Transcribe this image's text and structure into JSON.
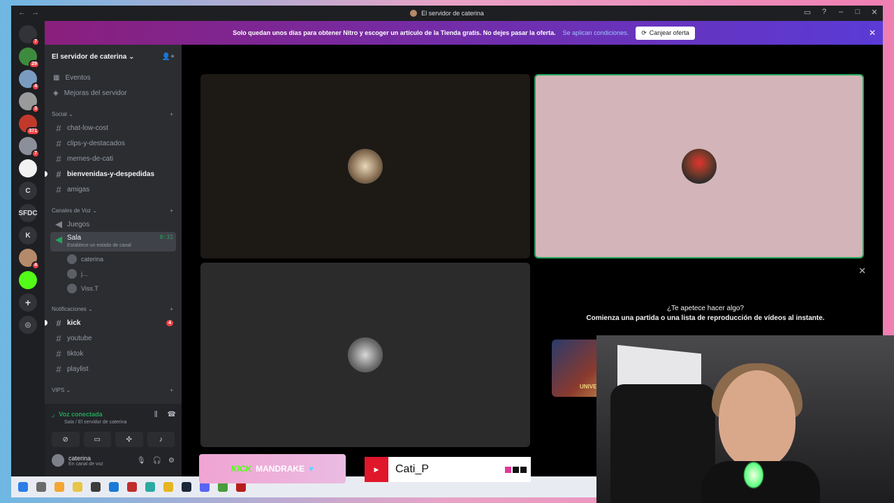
{
  "window": {
    "title": "El servidor de caterina"
  },
  "banner": {
    "text": "Solo quedan unos días para obtener Nitro y escoger un artículo de la Tienda gratis. No dejes pasar la oferta.",
    "terms_link": "Se aplican condiciones.",
    "offer_button": "Canjear oferta"
  },
  "rail": {
    "servers": [
      {
        "label": "",
        "badge": "7",
        "color": "#313338"
      },
      {
        "label": "",
        "badge": "29",
        "color": "#3e8a3e"
      },
      {
        "label": "",
        "badge": "4",
        "color": "#7a9bc0"
      },
      {
        "label": "",
        "badge": "3",
        "color": "#9a9a9a"
      },
      {
        "label": "",
        "badge": "371",
        "color": "#c0392b"
      },
      {
        "label": "",
        "badge": "7",
        "color": "#8a8f99"
      },
      {
        "label": "",
        "badge": "",
        "color": "#f2f2f2"
      },
      {
        "label": "C",
        "badge": "",
        "color": "#313338"
      },
      {
        "label": "SFDC",
        "badge": "",
        "color": "#313338"
      },
      {
        "label": "K",
        "badge": "",
        "color": "#313338"
      },
      {
        "label": "",
        "badge": "4",
        "color": "#b48a6a"
      },
      {
        "label": "",
        "badge": "",
        "color": "#53fc18"
      }
    ]
  },
  "sidebar": {
    "server_name": "El servidor de caterina",
    "utilities": [
      {
        "label": "Eventos"
      },
      {
        "label": "Mejoras del servidor"
      }
    ],
    "categories": [
      {
        "name": "Social",
        "channels": [
          {
            "name": "chat-low-cost",
            "unread": false
          },
          {
            "name": "clips-y-destacados",
            "unread": false
          },
          {
            "name": "memes-de-cati",
            "unread": false
          },
          {
            "name": "bienvenidas-y-despedidas",
            "unread": true
          },
          {
            "name": "amigas",
            "unread": false
          }
        ]
      }
    ],
    "voice_category": "Canales de Voz",
    "voice_channels": [
      {
        "name": "Juegos"
      },
      {
        "name": "Sala",
        "status": "Establece un estado de canal",
        "timer": "8:31"
      }
    ],
    "voice_users": [
      {
        "name": "caterina"
      },
      {
        "name": "j..."
      },
      {
        "name": "Viss.T"
      }
    ],
    "notif_category": "Notificaciones",
    "notif_channels": [
      {
        "name": "kick",
        "unread": true,
        "count": "4"
      },
      {
        "name": "youtube",
        "unread": false
      },
      {
        "name": "tiktok",
        "unread": false
      },
      {
        "name": "playlist",
        "unread": false
      }
    ],
    "vips_category": "VIPS"
  },
  "voice_panel": {
    "status": "Voz conectada",
    "location": "Sala / El servidor de caterina",
    "user_name": "caterina",
    "user_status": "En canal de voz"
  },
  "stage": {
    "activity_title": "¿Te apetece hacer algo?",
    "activity_subtitle": "Comienza una partida o una lista de reproducción de vídeos al instante.",
    "promo_logo": "UNIVE"
  },
  "overlays": {
    "kick_brand": "KICK",
    "kick_user": "MANDRAKE",
    "yt_name": "Cati_P"
  }
}
